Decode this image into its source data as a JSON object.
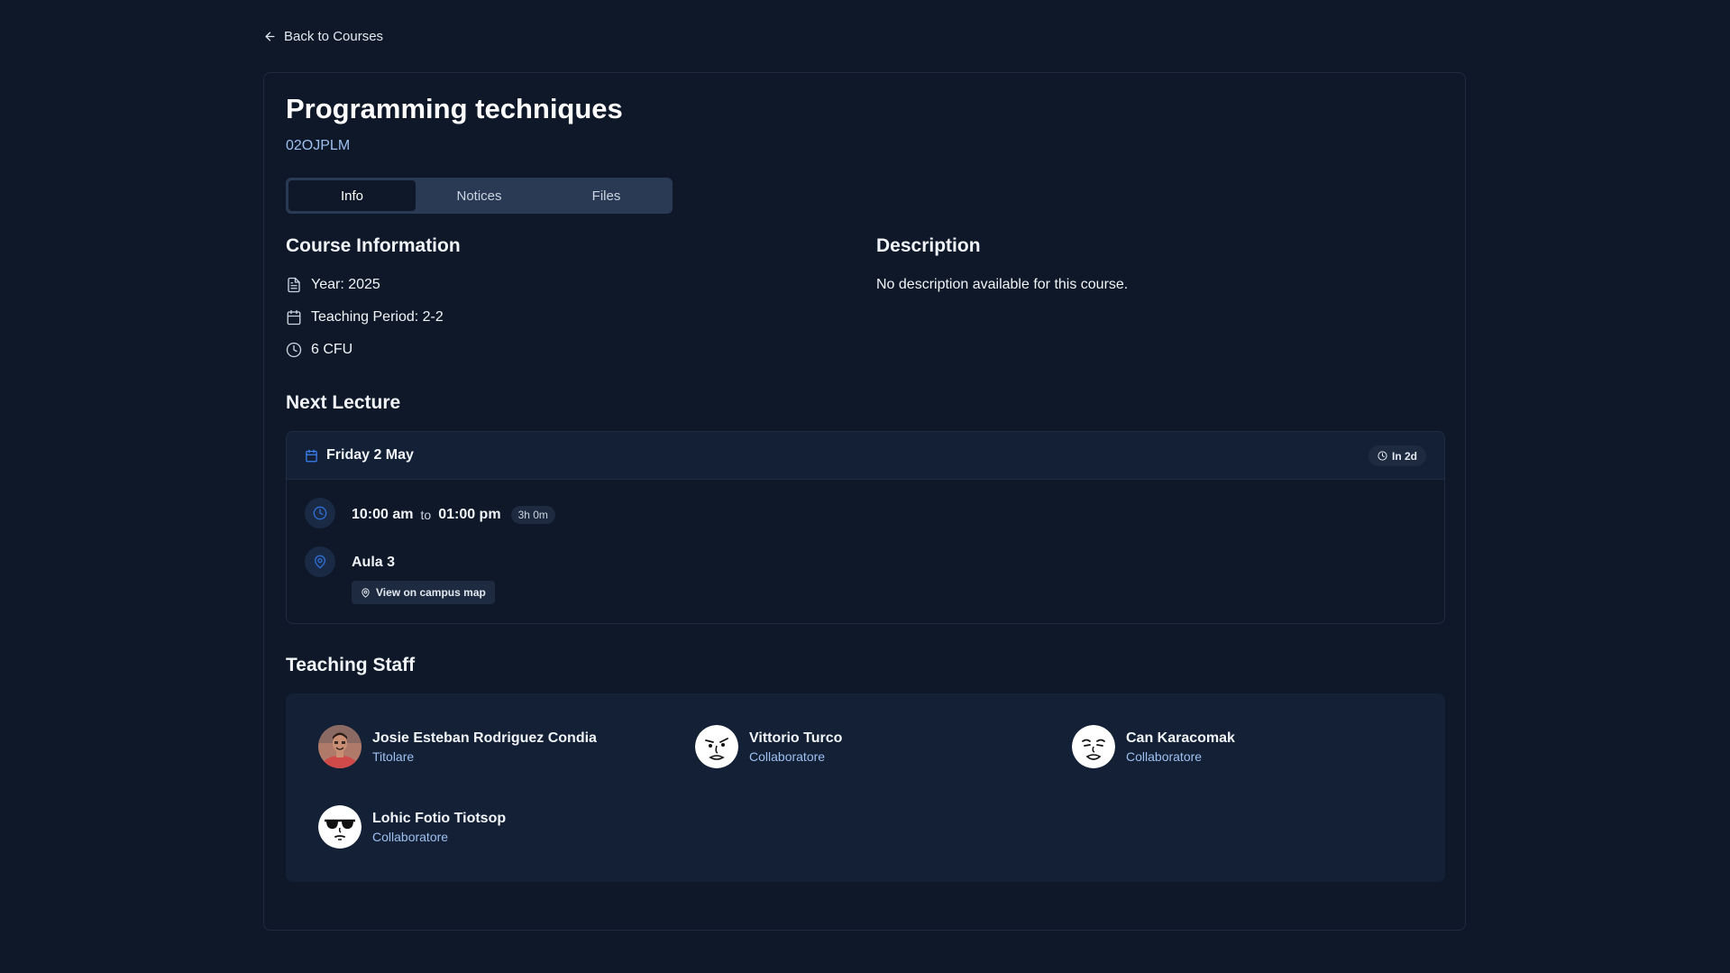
{
  "nav": {
    "back_label": "Back to Courses"
  },
  "course": {
    "title": "Programming techniques",
    "code": "02OJPLM"
  },
  "tabs": [
    {
      "label": "Info",
      "active": true
    },
    {
      "label": "Notices",
      "active": false
    },
    {
      "label": "Files",
      "active": false
    }
  ],
  "course_info": {
    "heading": "Course Information",
    "year": "Year: 2025",
    "teaching_period": "Teaching Period: 2-2",
    "credits": "6 CFU"
  },
  "description": {
    "heading": "Description",
    "text": "No description available for this course."
  },
  "next_lecture": {
    "heading": "Next Lecture",
    "date": "Friday 2 May",
    "countdown": "In 2d",
    "start_time": "10:00 am",
    "to_label": "to",
    "end_time": "01:00 pm",
    "duration": "3h 0m",
    "room": "Aula 3",
    "map_button": "View on campus map"
  },
  "teaching_staff": {
    "heading": "Teaching Staff",
    "members": [
      {
        "name": "Josie Esteban Rodriguez Condia",
        "role": "Titolare",
        "avatar": "photo-avatar"
      },
      {
        "name": "Vittorio Turco",
        "role": "Collaboratore",
        "avatar": "cartoon-face-avatar"
      },
      {
        "name": "Can Karacomak",
        "role": "Collaboratore",
        "avatar": "cartoon-face-avatar"
      },
      {
        "name": "Lohic Fotio Tiotsop",
        "role": "Collaboratore",
        "avatar": "sunglasses-face-avatar"
      }
    ]
  },
  "colors": {
    "background": "#0e1828",
    "panel": "#132036",
    "accent_text": "#9ec0f0",
    "icon_blue": "#3b82f6",
    "tab_bar": "#2a3a54"
  }
}
